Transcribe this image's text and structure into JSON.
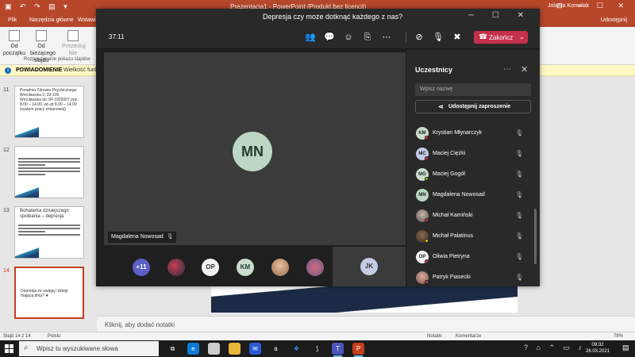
{
  "powerpoint": {
    "title_left": "Prezentacja1 - PowerPoint (Produkt bez licencji)",
    "user": "Jolanta Kornelak",
    "menu": [
      "Plik",
      "Narzędzia główne",
      "Wstawianie"
    ],
    "share": "Udostępnij",
    "ribbon": {
      "btn1": "Od początku",
      "btn2": "Od bieżącego slajdu",
      "btn3": "Prezentuj Nie",
      "btn3b": "online ~",
      "btn4": "Pokaz",
      "group": "Rozpoczynanie pokazu slajdów"
    },
    "notice": {
      "title": "POWIADOMIENIE",
      "text": "Wielkość funkcji"
    },
    "slides": [
      {
        "num": "11",
        "text": "Poradnia Zdrowia Psychicznego Wrocławska 2, 33-100 Wrocławska tel. 84 3392007 pon. 8.00 – 14.00, wt–pt 8.00 – 14.00 (system pracy zmianowej)"
      },
      {
        "num": "12",
        "text": ""
      },
      {
        "num": "13",
        "text": "Bohaterka dzisiejszego spotkania – depresja"
      },
      {
        "num": "14",
        "text": "Depresja ze uwagą i dzieję mającą dnia? ❦"
      }
    ],
    "notes_placeholder": "Kliknij, aby dodać notatki",
    "status": {
      "slide": "Slajd 14 z 14",
      "lang": "Polski",
      "notes": "Notatki",
      "comments": "Komentarze",
      "zoom": "78%"
    }
  },
  "taskbar": {
    "search_placeholder": "Wpisz tu wyszukiwane słowa",
    "time": "09:32",
    "date": "26.03.2021"
  },
  "teams": {
    "window_title": "Depresja czy może dotknąć każdego z nas?",
    "timer": "37:11",
    "leave_label": "Zakończ",
    "stage_initials": "MN",
    "stage_name": "Magdalena Nowosad",
    "strip": [
      "+11",
      "OP",
      "KM"
    ],
    "self_initials": "JK",
    "panel": {
      "title": "Uczestnicy",
      "search_placeholder": "Wpisz nazwę",
      "invite": "Udostępnij zaproszenie",
      "participants": [
        {
          "initials": "KM",
          "name": "Krystian Młynarczyk",
          "color": "#c9dccd"
        },
        {
          "initials": "MC",
          "name": "Maciej Ciężki",
          "color": "#c5cde6"
        },
        {
          "initials": "MG",
          "name": "Maciej Gogół",
          "color": "#c9dccd"
        },
        {
          "initials": "MN",
          "name": "Magdalena Nowosad",
          "color": "#bcd7c4"
        },
        {
          "initials": "",
          "name": "Michał Kamiński",
          "color": "#8a7f80"
        },
        {
          "initials": "",
          "name": "Michał Palatinus",
          "color": "#6b4a3a"
        },
        {
          "initials": "OP",
          "name": "Oliwia Pietryna",
          "color": "#f2f2f2"
        },
        {
          "initials": "",
          "name": "Patryk Piasecki",
          "color": "#b58a7a"
        }
      ]
    }
  }
}
